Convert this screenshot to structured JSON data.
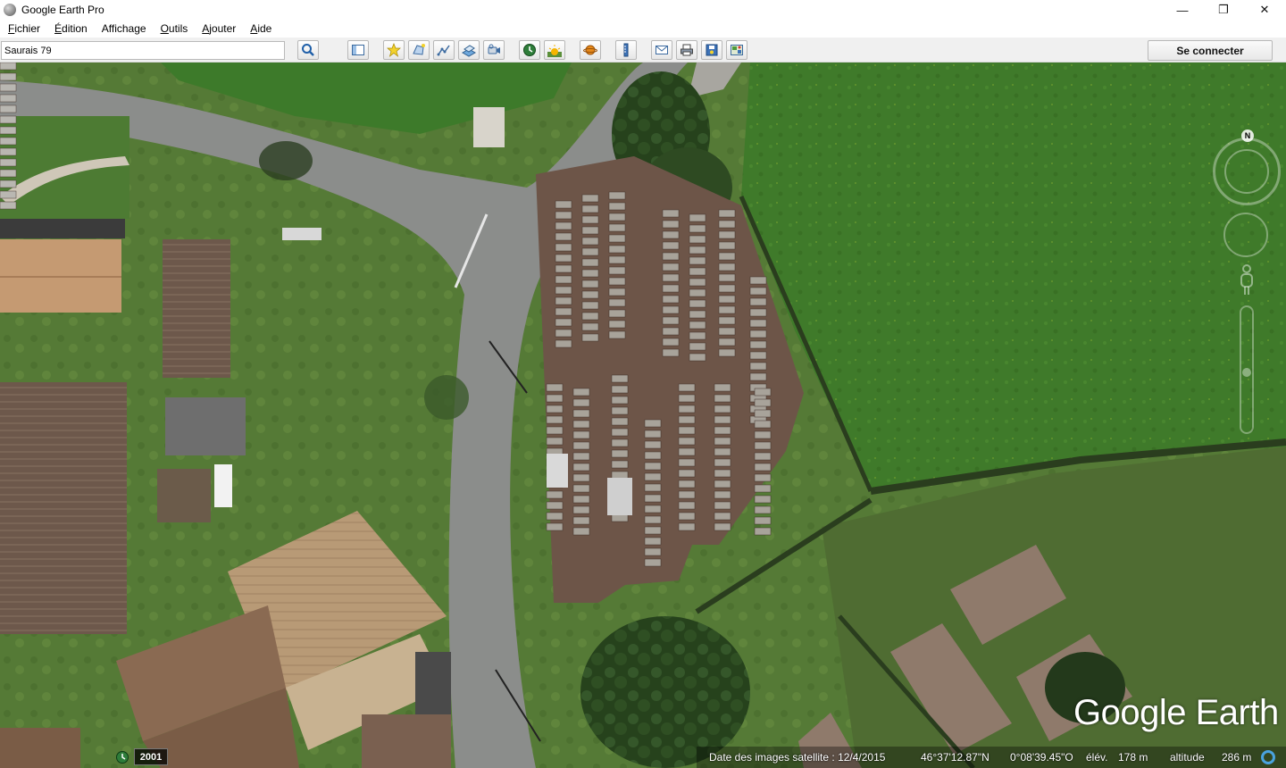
{
  "window": {
    "title": "Google Earth Pro",
    "controls": {
      "minimize": "—",
      "maximize": "❐",
      "close": "✕"
    }
  },
  "menu": [
    {
      "label": "Fichier",
      "access_key": "F",
      "rest": "ichier"
    },
    {
      "label": "Édition",
      "access_key": "É",
      "rest": "dition"
    },
    {
      "label": "Affichage",
      "access_key": "",
      "rest": "Affichage"
    },
    {
      "label": "Outils",
      "access_key": "O",
      "rest": "utils"
    },
    {
      "label": "Ajouter",
      "access_key": "A",
      "rest": "jouter"
    },
    {
      "label": "Aide",
      "access_key": "A",
      "rest": "ide"
    }
  ],
  "toolbar": {
    "search_value": "Saurais 79",
    "search_button_icon": "magnifier-icon",
    "tools": [
      "sidebar-toggle-icon",
      "add-placemark-icon",
      "add-polygon-icon",
      "add-path-icon",
      "add-image-overlay-icon",
      "record-tour-icon",
      "historical-imagery-icon",
      "sunlight-icon",
      "planets-icon",
      "ruler-icon",
      "email-icon",
      "print-icon",
      "save-image-icon",
      "view-in-maps-icon"
    ],
    "connect_label": "Se connecter"
  },
  "map": {
    "compass_letter": "N",
    "logo_text": "Google Earth"
  },
  "status": {
    "year": "2001",
    "imagery_date_label": "Date des images satellite : 12/4/2015",
    "latitude": "46°37'12.87\"N",
    "longitude": "0°08'39.45\"O",
    "elevation_label": "élév.",
    "elevation_value": "178 m",
    "altitude_label": "altitude",
    "altitude_value": "286 m"
  },
  "colors": {
    "field_green": "#3f7a2a",
    "road_gray": "#8d8f8e",
    "cemetery_ground": "#6d5548",
    "accent_blue": "#4aa3df"
  }
}
